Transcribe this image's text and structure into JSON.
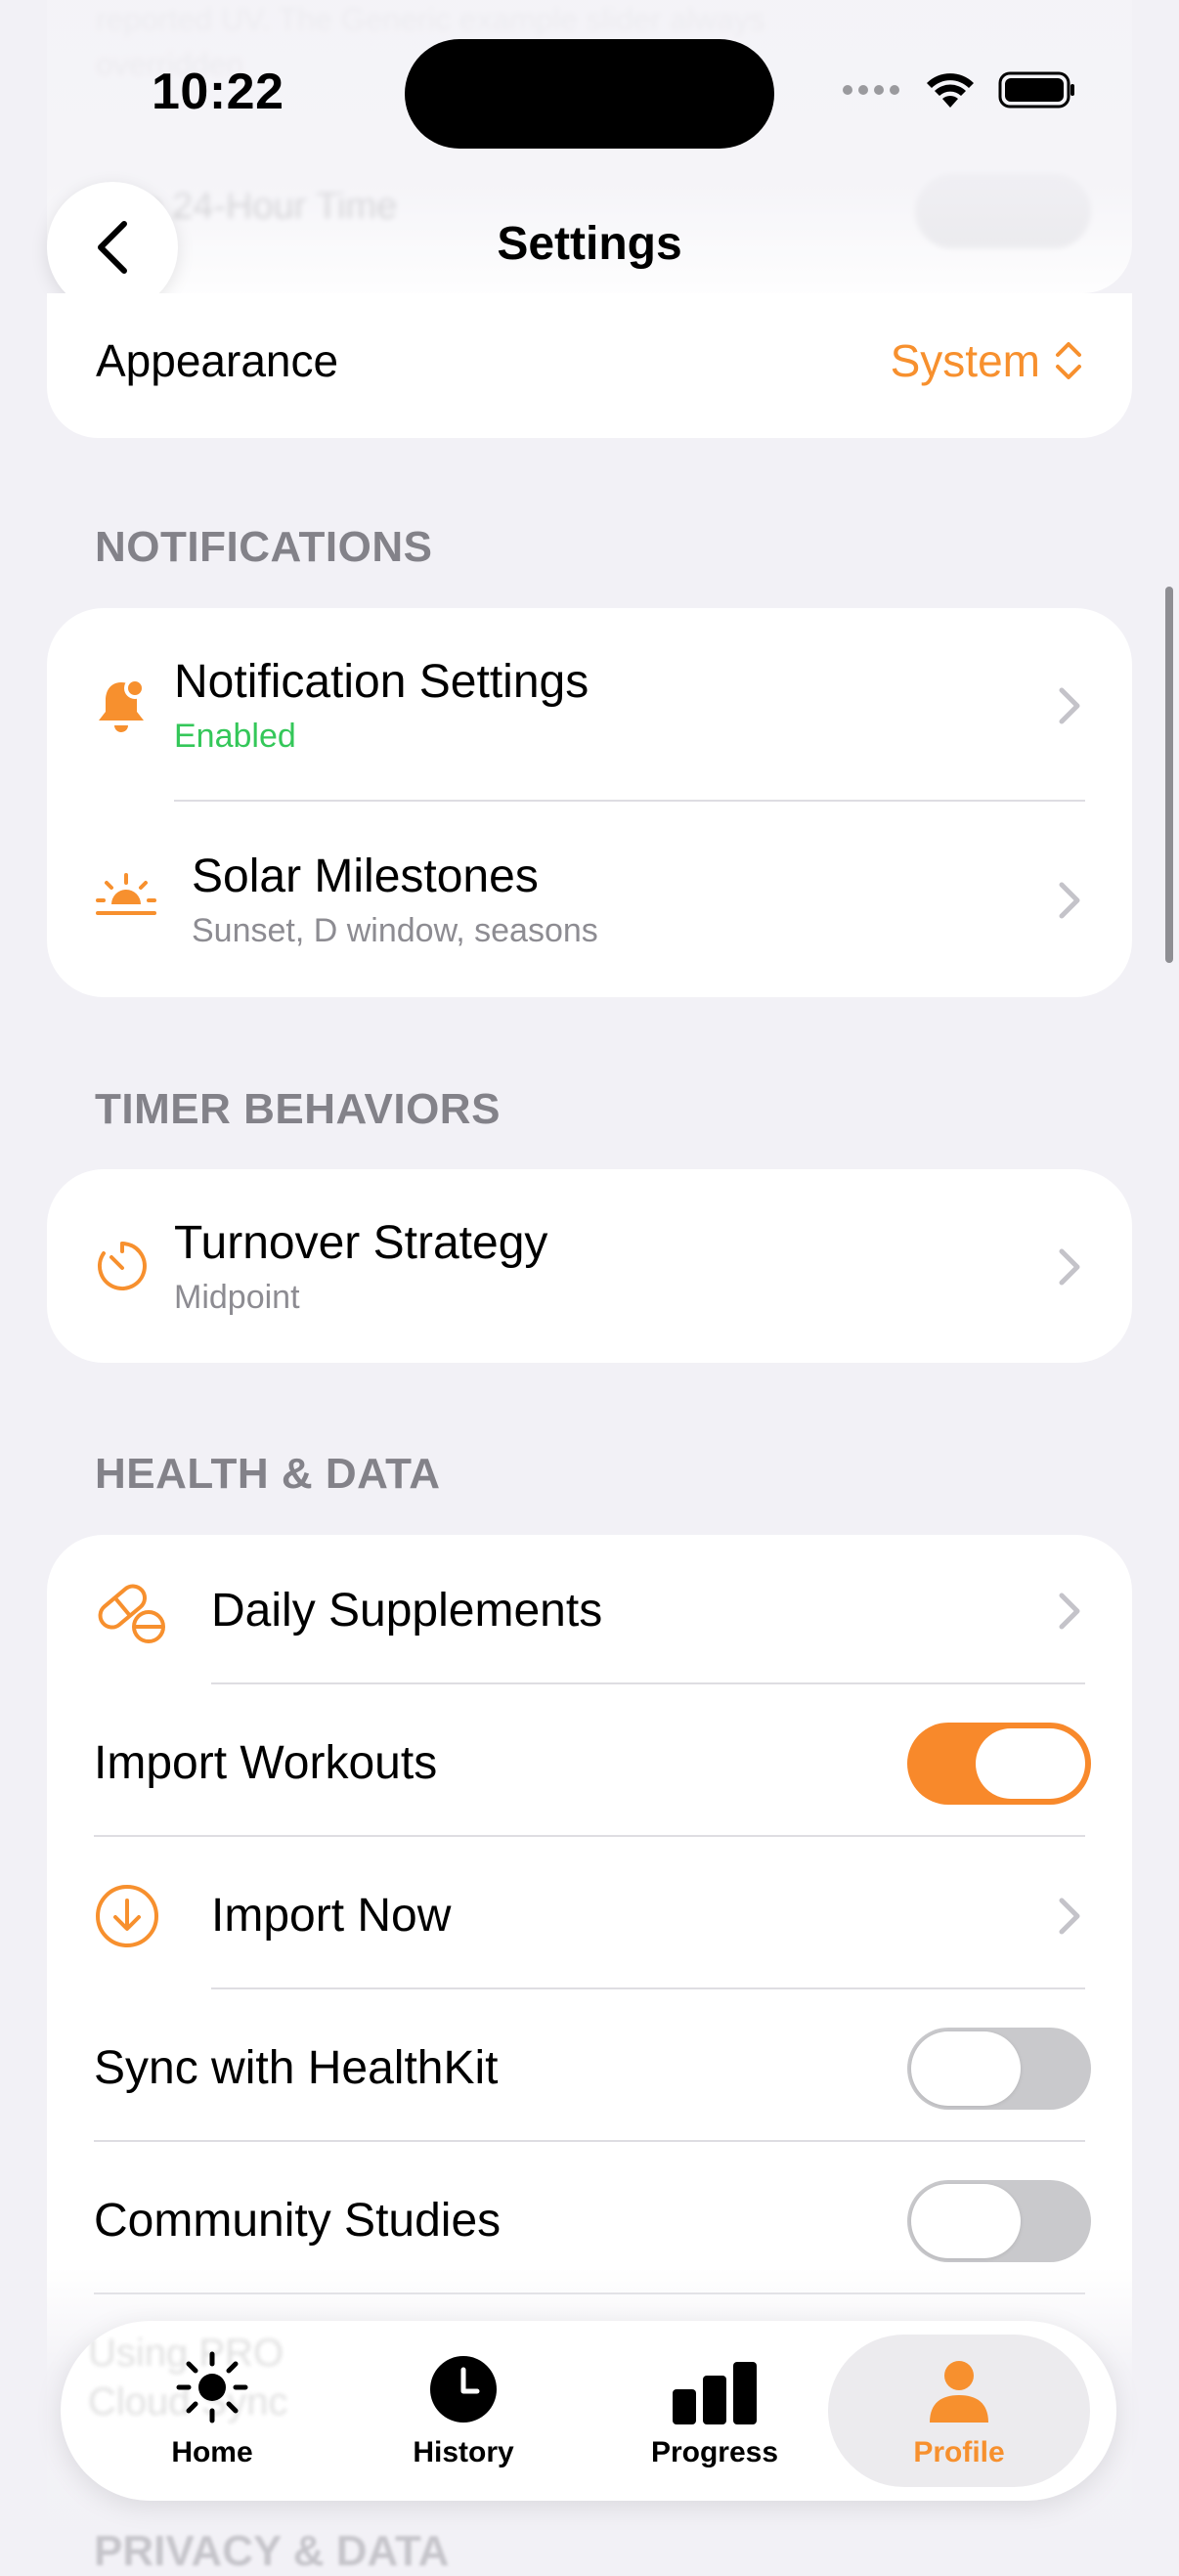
{
  "status_bar": {
    "time": "10:22"
  },
  "behind_header": {
    "text_line_1": "reported UV. The Generic example slider always",
    "text_line_2": "overridden",
    "text_line_3": "Use 24-Hour Time"
  },
  "nav": {
    "title": "Settings"
  },
  "appearance": {
    "label": "Appearance",
    "value": "System"
  },
  "sections": {
    "notifications": {
      "header": "NOTIFICATIONS",
      "rows": [
        {
          "title": "Notification Settings",
          "subtitle": "Enabled",
          "icon": "bell-icon"
        },
        {
          "title": "Solar Milestones",
          "subtitle": "Sunset, D window, seasons",
          "icon": "sunset-icon"
        }
      ]
    },
    "timer": {
      "header": "TIMER BEHAVIORS",
      "rows": [
        {
          "title": "Turnover Strategy",
          "subtitle": "Midpoint",
          "icon": "timer-icon"
        }
      ]
    },
    "health": {
      "header": "HEALTH & DATA",
      "rows": [
        {
          "title": "Daily Supplements",
          "icon": "pill-icon"
        },
        {
          "title": "Import Workouts",
          "toggle": true
        },
        {
          "title": "Import Now",
          "icon": "download-icon"
        },
        {
          "title": "Sync with HealthKit",
          "toggle": false
        },
        {
          "title": "Community Studies",
          "toggle": false
        }
      ]
    }
  },
  "tab_ghost": {
    "line1": "Using PRO",
    "line2": "Cloud Sync"
  },
  "next_section_peek": "PRIVACY & DATA",
  "tabs": [
    {
      "label": "Home",
      "icon": "sun-icon"
    },
    {
      "label": "History",
      "icon": "clock-icon"
    },
    {
      "label": "Progress",
      "icon": "bar-chart-icon"
    },
    {
      "label": "Profile",
      "icon": "person-icon"
    }
  ],
  "colors": {
    "accent": "#f7902e",
    "enabled_green": "#34c759",
    "background": "#f2f1f6"
  }
}
